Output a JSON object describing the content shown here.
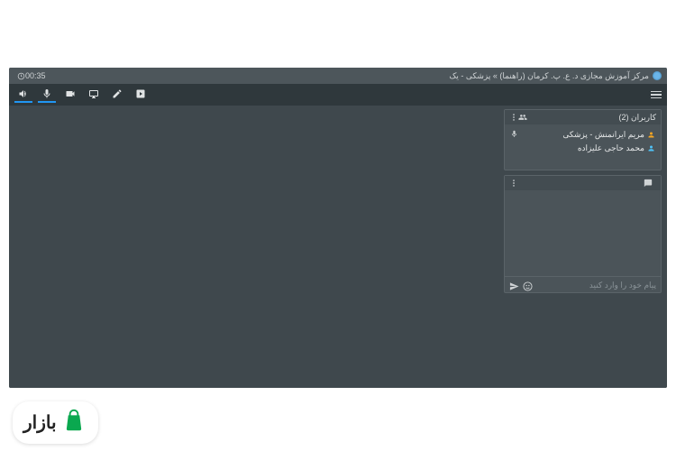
{
  "titlebar": {
    "title": "مرکز آموزش مجازی د. ع. پ. کرمان (راهنما) » پزشکی - یک",
    "timer": "00:35"
  },
  "users_panel": {
    "title": "کاربران (2)",
    "items": [
      {
        "name": "مریم ایرانمنش - پزشکی",
        "mic": true,
        "color": "#f5a623"
      },
      {
        "name": "محمد حاجی علیزاده",
        "mic": false,
        "color": "#4fc3f7"
      }
    ]
  },
  "chat_panel": {
    "placeholder": "پیام خود را وارد کنید"
  },
  "brand": {
    "text": "بازار"
  }
}
